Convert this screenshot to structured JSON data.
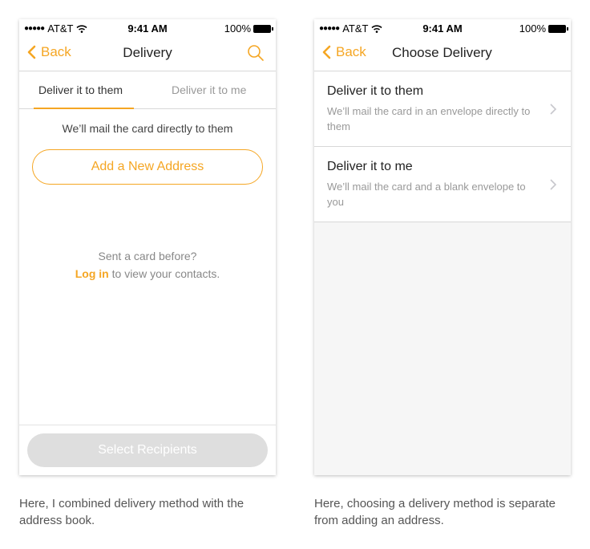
{
  "left_screen": {
    "status": {
      "carrier": "AT&T",
      "time": "9:41 AM",
      "battery": "100%"
    },
    "nav": {
      "back": "Back",
      "title": "Delivery"
    },
    "tabs": [
      "Deliver it to them",
      "Deliver it to me"
    ],
    "message": "We’ll mail the card directly to them",
    "add_address": "Add a New Address",
    "sent_before": "Sent a card before?",
    "login_link": "Log in",
    "login_rest": " to view your contacts.",
    "select_button": "Select Recipients"
  },
  "right_screen": {
    "status": {
      "carrier": "AT&T",
      "time": "9:41 AM",
      "battery": "100%"
    },
    "nav": {
      "back": "Back",
      "title": "Choose Delivery"
    },
    "options": [
      {
        "title": "Deliver it to them",
        "desc": "We’ll mail the card in an envelope directly to them"
      },
      {
        "title": "Deliver it to me",
        "desc": "We’ll mail the card and a blank envelope to you"
      }
    ]
  },
  "captions": {
    "left": "Here, I combined delivery method with the address book.",
    "right": "Here, choosing a delivery method is separate from adding an address."
  },
  "colors": {
    "accent": "#f5a623"
  }
}
